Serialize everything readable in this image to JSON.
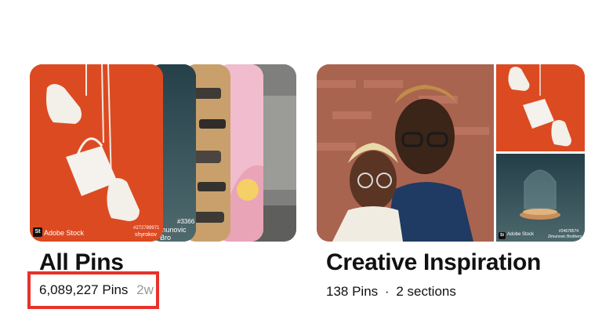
{
  "boards": [
    {
      "title": "All Pins",
      "pin_count": "6,089,227 Pins",
      "extra": "2w",
      "highlighted": true,
      "watermark": "Adobe Stock",
      "stock_ids": [
        "#272789971",
        "shyrokov",
        "#3366",
        "munovic Bro"
      ]
    },
    {
      "title": "Creative Inspiration",
      "pin_count": "138 Pins",
      "separator": "·",
      "sections": "2 sections",
      "watermark": "Adobe Stock",
      "stock_ids": [
        "#24678574",
        "Zimunovic Brothers"
      ]
    }
  ],
  "colors": {
    "orange_bg": "#dd4a22",
    "teal_bg": "#2f4a52",
    "pink": "#efb6c8",
    "highlight": "#e8322a"
  }
}
